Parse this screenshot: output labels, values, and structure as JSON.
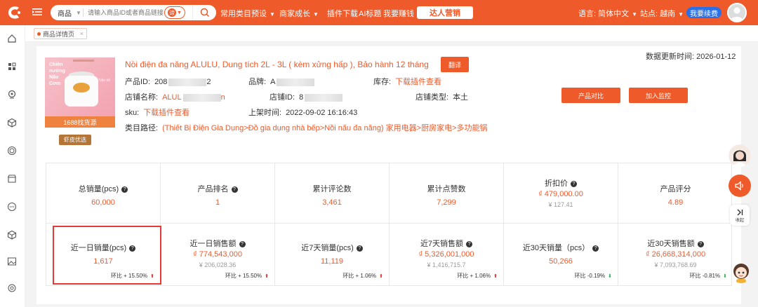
{
  "header": {
    "search_type": "商品",
    "search_placeholder": "请输入商品ID或者商品链接",
    "search_mode_glyph": "谛",
    "nav": [
      {
        "label": "常用类目预设",
        "has_dropdown": true
      },
      {
        "label": "商家成长",
        "has_dropdown": true
      },
      {
        "label": "插件下载",
        "has_dropdown": false
      },
      {
        "label": "AI标题",
        "has_dropdown": false
      },
      {
        "label": "我要赚钱",
        "has_dropdown": false
      }
    ],
    "highlight_nav": "达人营销",
    "language": "语言: 简体中文",
    "site": "站点: 越南",
    "renew": "我要续费"
  },
  "tabs": [
    {
      "label": "商品详情页",
      "close": "×"
    }
  ],
  "product": {
    "image_text": "Chiên nướng Nấu Cơm",
    "image_side_text": "Trộn tốt",
    "image_badge": "1688找货源",
    "shopee_badge": "虾皮优选",
    "title": "Nồi điện đa năng ALULU, Dung tích 2L - 3L ( kèm xửng hấp ), Bảo hành 12 tháng",
    "translate": "翻译",
    "updated_label": "数据更新时间:",
    "updated_value": "2026-01-12",
    "product_id_label": "产品ID:",
    "product_id_prefix": "208",
    "product_id_suffix": "2",
    "brand_label": "品牌:",
    "brand_value": "A",
    "stock_label": "库存:",
    "stock_value": "下载插件查看",
    "shop_name_label": "店铺名称:",
    "shop_name_prefix": "ALUL",
    "shop_name_suffix": "n",
    "shop_id_label": "店铺ID:",
    "shop_id_prefix": "8",
    "shop_type_label": "店铺类型:",
    "shop_type_value": "本土",
    "sku_label": "sku:",
    "sku_value": "下载插件查看",
    "listed_label": "上架时间:",
    "listed_value": "2022-09-02 16:16:43",
    "category_label": "类目路径:",
    "category_value": "(Thiết Bị Điện Gia Dụng>Đồ gia dụng nhà bếp>Nồi nấu đa năng) 家用电器>厨房家电>多功能锅",
    "compare_btn": "产品对比",
    "monitor_btn": "加入监控"
  },
  "stats_row1": [
    {
      "label": "总销量(pcs)",
      "help": true,
      "value": "60,000",
      "sub": ""
    },
    {
      "label": "产品排名",
      "help": true,
      "value": "1",
      "sub": ""
    },
    {
      "label": "累计评论数",
      "help": false,
      "value": "3,461",
      "sub": ""
    },
    {
      "label": "累计点赞数",
      "help": false,
      "value": "7,299",
      "sub": ""
    },
    {
      "label": "折扣价",
      "help": true,
      "value": "₫ 479,000.00",
      "sub": "¥ 127.41"
    },
    {
      "label": "产品评分",
      "help": false,
      "value": "4.89",
      "sub": ""
    }
  ],
  "stats_row2": [
    {
      "label": "近一日销量(pcs)",
      "help": true,
      "value": "1,617",
      "sub": "",
      "change": "环比 + 15.50%",
      "dir": "up"
    },
    {
      "label": "近一日销售额",
      "help": true,
      "value": "₫ 774,543,000",
      "sub": "¥ 206,028.36",
      "change": "环比 + 15.50%",
      "dir": "up"
    },
    {
      "label": "近7天销量(pcs)",
      "help": true,
      "value": "11,119",
      "sub": "",
      "change": "环比 + 1.06%",
      "dir": "up"
    },
    {
      "label": "近7天销售额",
      "help": true,
      "value": "₫ 5,326,001,000",
      "sub": "¥ 1,416,715.7",
      "change": "环比 + 1.06%",
      "dir": "up"
    },
    {
      "label": "近30天销量（pcs）",
      "help": true,
      "value": "50,266",
      "sub": "",
      "change": "环比 -0.19%",
      "dir": "down"
    },
    {
      "label": "近30天销售额",
      "help": true,
      "value": "₫ 26,668,314,000",
      "sub": "¥ 7,093,768.69",
      "change": "环比 -0.81%",
      "dir": "down"
    }
  ],
  "float": {
    "collapse_label": "收起"
  },
  "colors": {
    "brand": "#ef5a2b",
    "renew": "#2b6fe6",
    "highlight_border": "#e53935"
  }
}
